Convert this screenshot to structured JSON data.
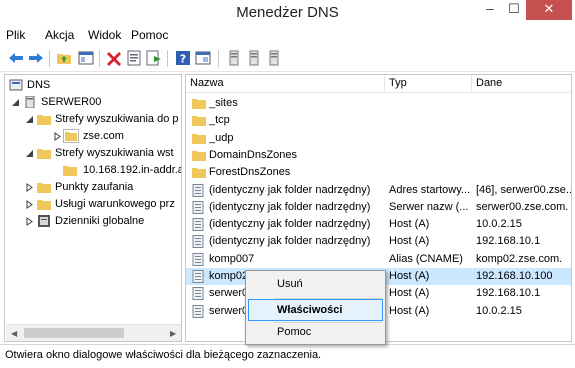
{
  "window": {
    "title": "Menedżer DNS",
    "controls": [
      "–",
      "☐",
      "✕"
    ]
  },
  "menu": [
    "Plik",
    "Akcja",
    "Widok",
    "Pomoc"
  ],
  "tree": {
    "items": [
      {
        "label": "DNS",
        "icon": "dns-icon",
        "expander": ""
      },
      {
        "label": "SERWER00",
        "icon": "server-icon",
        "expander": "open"
      },
      {
        "label": "Strefy wyszukiwania do p",
        "icon": "folder-icon",
        "expander": "open"
      },
      {
        "label": "zse.com",
        "icon": "zone-icon",
        "expander": "closed"
      },
      {
        "label": "Strefy wyszukiwania wst",
        "icon": "folder-icon",
        "expander": "open"
      },
      {
        "label": "10.168.192.in-addr.ar",
        "icon": "zone-icon",
        "expander": ""
      },
      {
        "label": "Punkty zaufania",
        "icon": "folder-icon",
        "expander": "closed"
      },
      {
        "label": "Usługi warunkowego prz",
        "icon": "folder-icon",
        "expander": "closed"
      },
      {
        "label": "Dzienniki globalne",
        "icon": "log-icon",
        "expander": "closed"
      }
    ]
  },
  "list": {
    "columns": [
      "Nazwa",
      "Typ",
      "Dane"
    ],
    "rows": [
      {
        "name": "_sites",
        "type": "",
        "data": "",
        "icon": "folder-icon"
      },
      {
        "name": "_tcp",
        "type": "",
        "data": "",
        "icon": "folder-icon"
      },
      {
        "name": "_udp",
        "type": "",
        "data": "",
        "icon": "folder-icon"
      },
      {
        "name": "DomainDnsZones",
        "type": "",
        "data": "",
        "icon": "folder-icon"
      },
      {
        "name": "ForestDnsZones",
        "type": "",
        "data": "",
        "icon": "folder-icon"
      },
      {
        "name": "(identyczny jak folder nadrzędny)",
        "type": "Adres startowy...",
        "data": "[46], serwer00.zse...",
        "icon": "record-icon"
      },
      {
        "name": "(identyczny jak folder nadrzędny)",
        "type": "Serwer nazw (...",
        "data": "serwer00.zse.com.",
        "icon": "record-icon"
      },
      {
        "name": "(identyczny jak folder nadrzędny)",
        "type": "Host (A)",
        "data": "10.0.2.15",
        "icon": "record-icon"
      },
      {
        "name": "(identyczny jak folder nadrzędny)",
        "type": "Host (A)",
        "data": "192.168.10.1",
        "icon": "record-icon"
      },
      {
        "name": "komp007",
        "type": "Alias (CNAME)",
        "data": "komp02.zse.com.",
        "icon": "record-icon"
      },
      {
        "name": "komp02",
        "type": "Host (A)",
        "data": "192.168.10.100",
        "icon": "record-icon",
        "selected": true
      },
      {
        "name": "serwer00",
        "type": "Host (A)",
        "data": "192.168.10.1",
        "icon": "record-icon"
      },
      {
        "name": "serwer00",
        "type": "Host (A)",
        "data": "10.0.2.15",
        "icon": "record-icon"
      }
    ]
  },
  "context_menu": {
    "items": [
      "Usuń",
      "Właściwości",
      "Pomoc"
    ],
    "highlighted": "Właściwości"
  },
  "status": "Otwiera okno dialogowe właściwości dla bieżącego zaznaczenia.",
  "colors": {
    "selection": "#cce8ff",
    "close_button": "#c75050",
    "folder": "#f0c75a",
    "highlight_border": "#3399ff"
  }
}
